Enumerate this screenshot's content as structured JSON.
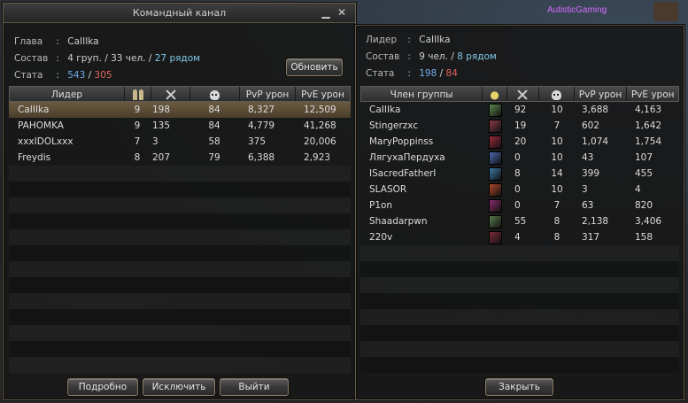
{
  "stream": {
    "tag": "AutisticGaming"
  },
  "left_window": {
    "title": "Командный канал",
    "min_glyph": "▁",
    "close_glyph": "✕",
    "info": {
      "leader_label": "Глава",
      "leader_value": "CaIIIka",
      "comp_label": "Состав",
      "comp_groups": "4 груп.",
      "comp_people": "33 чел.",
      "comp_nearby": "27 рядом",
      "stat_label": "Стата",
      "stat_kills": "543",
      "stat_deaths": "305",
      "colon": ":",
      "slash": "/"
    },
    "refresh_button": "Обновить",
    "columns": [
      "Лидер",
      "",
      "",
      "",
      "PvP урон",
      "PvE урон"
    ],
    "column_icons": [
      "",
      "people-icon",
      "swords-icon",
      "skull-icon",
      "",
      ""
    ],
    "rows": [
      {
        "name": "CaIIIka",
        "members": "9",
        "kills": "198",
        "deaths": "84",
        "pvp": "8,327",
        "pve": "12,509",
        "selected": true
      },
      {
        "name": "PAHOMKA",
        "members": "9",
        "kills": "135",
        "deaths": "84",
        "pvp": "4,779",
        "pve": "41,268",
        "selected": false
      },
      {
        "name": "xxxIDOLxxx",
        "members": "7",
        "kills": "3",
        "deaths": "58",
        "pvp": "375",
        "pve": "20,006",
        "selected": false
      },
      {
        "name": "Freydis",
        "members": "8",
        "kills": "207",
        "deaths": "79",
        "pvp": "6,388",
        "pve": "2,923",
        "selected": false
      }
    ],
    "buttons": {
      "details": "Подробно",
      "kick": "Исключить",
      "leave": "Выйти"
    }
  },
  "right_window": {
    "info": {
      "leader_label": "Лидер",
      "leader_value": "CaIIIka",
      "comp_label": "Состав",
      "comp_people": "9 чел.",
      "comp_nearby": "8 рядом",
      "stat_label": "Стата",
      "stat_kills": "198",
      "stat_deaths": "84",
      "colon": ":",
      "slash": "/"
    },
    "columns": [
      "Член группы",
      "",
      "",
      "",
      "PvP урон",
      "PvE урон"
    ],
    "column_icons": [
      "",
      "star-icon",
      "swords-icon",
      "skull-icon",
      "",
      ""
    ],
    "rows": [
      {
        "name": "CaIIIka",
        "class_color": "#5e8a4e",
        "kills": "92",
        "deaths": "10",
        "pvp": "3,688",
        "pve": "4,163"
      },
      {
        "name": "Stingerzxc",
        "class_color": "#8a3a4a",
        "kills": "19",
        "deaths": "7",
        "pvp": "602",
        "pve": "1,642"
      },
      {
        "name": "MaryPoppinss",
        "class_color": "#9a2a3a",
        "kills": "20",
        "deaths": "10",
        "pvp": "1,074",
        "pve": "1,754"
      },
      {
        "name": "ЛягухаПердуха",
        "class_color": "#4a6ab0",
        "kills": "0",
        "deaths": "10",
        "pvp": "43",
        "pve": "107"
      },
      {
        "name": "ISacredFatherI",
        "class_color": "#3a7aa8",
        "kills": "8",
        "deaths": "14",
        "pvp": "399",
        "pve": "455"
      },
      {
        "name": "SLASOR",
        "class_color": "#b04a2a",
        "kills": "0",
        "deaths": "10",
        "pvp": "3",
        "pve": "4"
      },
      {
        "name": "P1on",
        "class_color": "#8a2a6a",
        "kills": "0",
        "deaths": "7",
        "pvp": "63",
        "pve": "820"
      },
      {
        "name": "Shaadarpwn",
        "class_color": "#5a7a4a",
        "kills": "55",
        "deaths": "8",
        "pvp": "2,138",
        "pve": "3,406"
      },
      {
        "name": "220v",
        "class_color": "#7a2a3a",
        "kills": "4",
        "deaths": "8",
        "pvp": "317",
        "pve": "158"
      }
    ],
    "close_button": "Закрыть"
  }
}
